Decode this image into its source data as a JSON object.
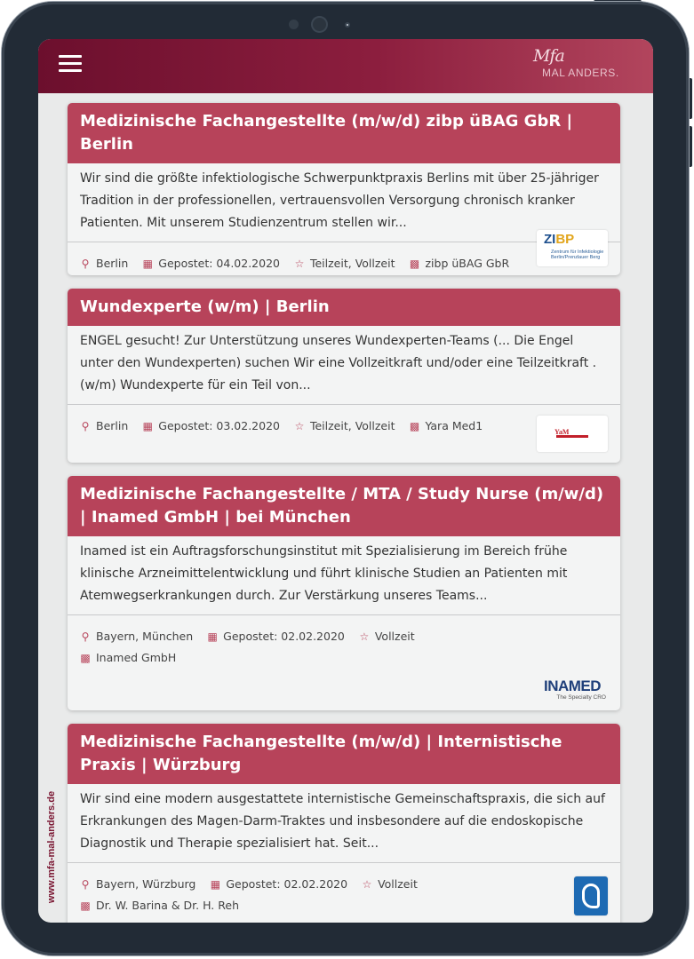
{
  "header": {
    "menu_icon": "hamburger-menu-icon",
    "logo_script": "Mfa",
    "logo_text": "MAL ANDERS."
  },
  "side_url": "www.mfa-mal-anders.de",
  "icons": {
    "location": "map-pin-icon",
    "date": "calendar-icon",
    "type": "star-outline-icon",
    "company": "building-icon"
  },
  "accent_color": "#b7435a",
  "jobs": [
    {
      "title": "Medizinische Fachangestellte (m/w/d) zibp üBAG GbR | Berlin",
      "description": "Wir sind die größte infektiologische Schwerpunktpraxis Berlins mit über 25-jähriger Tradition in der professionellen, vertrauensvollen Versorgung chronisch kranker Patienten. Mit unserem Studienzentrum stellen wir...",
      "location": "Berlin",
      "posted": "Gepostet: 04.02.2020",
      "type": "Teilzeit, Vollzeit",
      "company": "zibp üBAG GbR",
      "logo_big_1": "ZI",
      "logo_big_2": "BP",
      "logo_small": "Zentrum für Infektiologie Berlin/Prenzlauer Berg"
    },
    {
      "title": "Wundexperte (w/m) | Berlin",
      "description": "ENGEL gesucht! Zur Unterstützung unseres Wundexperten-Teams (... Die Engel unter den Wundexperten) suchen Wir eine Vollzeitkraft und/oder eine Teilzeitkraft  .  (w/m) Wundexperte für ein Teil von...",
      "location": "Berlin",
      "posted": "Gepostet: 03.02.2020",
      "type": "Teilzeit, Vollzeit",
      "company": "Yara Med1",
      "logo_text": "YaM"
    },
    {
      "title": "Medizinische Fachangestellte / MTA / Study Nurse (m/w/d) | Inamed GmbH | bei München",
      "description": "Inamed ist ein Auftragsforschungsinstitut mit Spezialisierung im Bereich frühe klinische Arzneimittelentwicklung und führt klinische Studien an Patienten mit Atemwegserkrankungen durch. Zur Verstärkung unseres Teams...",
      "location": "Bayern, München",
      "posted": "Gepostet: 02.02.2020",
      "type": "Vollzeit",
      "company": "Inamed GmbH",
      "logo_big": "INAMED",
      "logo_small": "The Specialty CRO"
    },
    {
      "title": "Medizinische Fachangestellte (m/w/d) | Internistische Praxis | Würzburg",
      "description": "Wir sind eine modern ausgestattete internistische Gemeinschaftspraxis, die sich auf Erkrankungen des Magen-Darm-Traktes und insbesondere auf die endoskopische Diagnostik und Therapie spezialisiert hat. Seit...",
      "location": "Bayern, Würzburg",
      "posted": "Gepostet: 02.02.2020",
      "type": "Vollzeit",
      "company": "Dr. W. Barina & Dr. H. Reh"
    }
  ]
}
